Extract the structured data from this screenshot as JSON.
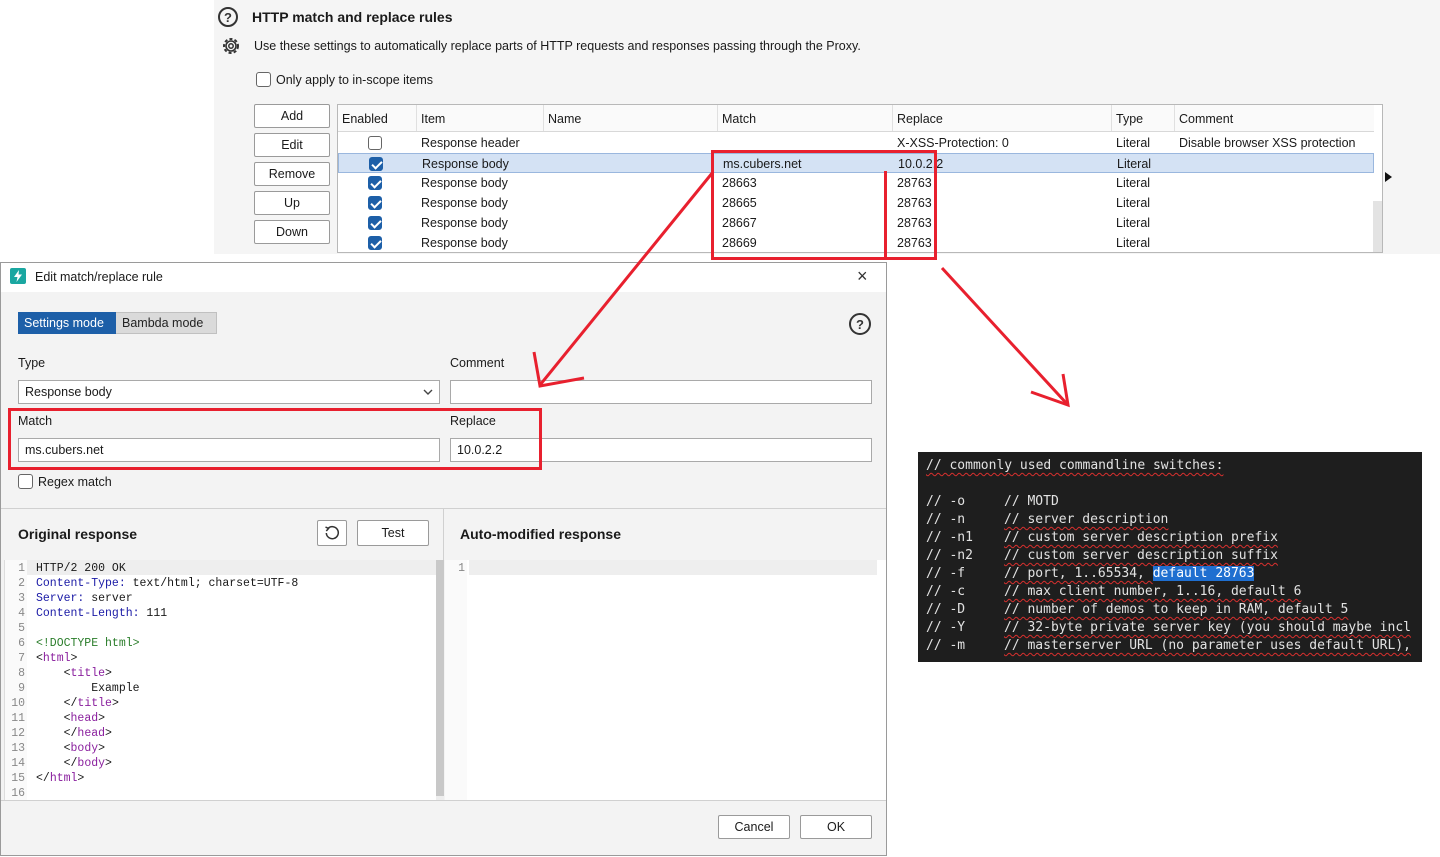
{
  "settings": {
    "section_title": "HTTP match and replace rules",
    "description": "Use these settings to automatically replace parts of HTTP requests and responses passing through the Proxy.",
    "in_scope_label": "Only apply to in-scope items",
    "in_scope_checked": false,
    "buttons": {
      "add": "Add",
      "edit": "Edit",
      "remove": "Remove",
      "up": "Up",
      "down": "Down"
    }
  },
  "rules_table": {
    "columns": [
      "Enabled",
      "Item",
      "Name",
      "Match",
      "Replace",
      "Type",
      "Comment"
    ],
    "rows": [
      {
        "enabled": false,
        "item": "Response header",
        "name": "",
        "match": "",
        "replace": "X-XSS-Protection: 0",
        "type": "Literal",
        "comment": "Disable browser XSS protection",
        "selected": false
      },
      {
        "enabled": true,
        "item": "Response body",
        "name": "",
        "match": "ms.cubers.net",
        "replace": "10.0.2.2",
        "type": "Literal",
        "comment": "",
        "selected": true
      },
      {
        "enabled": true,
        "item": "Response body",
        "name": "",
        "match": "28663",
        "replace": "28763",
        "type": "Literal",
        "comment": "",
        "selected": false
      },
      {
        "enabled": true,
        "item": "Response body",
        "name": "",
        "match": "28665",
        "replace": "28763",
        "type": "Literal",
        "comment": "",
        "selected": false
      },
      {
        "enabled": true,
        "item": "Response body",
        "name": "",
        "match": "28667",
        "replace": "28763",
        "type": "Literal",
        "comment": "",
        "selected": false
      },
      {
        "enabled": true,
        "item": "Response body",
        "name": "",
        "match": "28669",
        "replace": "28763",
        "type": "Literal",
        "comment": "",
        "selected": false
      }
    ]
  },
  "dialog": {
    "title": "Edit match/replace rule",
    "close": "×",
    "modes": {
      "settings": "Settings mode",
      "bambda": "Bambda mode",
      "active": "settings"
    },
    "help": "?",
    "type_label": "Type",
    "type_value": "Response body",
    "comment_label": "Comment",
    "comment_value": "",
    "match_label": "Match",
    "match_value": "ms.cubers.net",
    "replace_label": "Replace",
    "replace_value": "10.0.2.2",
    "regex_label": "Regex match",
    "regex_checked": false,
    "original_title": "Original response",
    "test_button": "Test",
    "modified_title": "Auto-modified response",
    "modified_line_number": "1",
    "cancel": "Cancel",
    "ok": "OK",
    "original_lines": [
      "HTTP/2 200 OK",
      "Content-Type: text/html; charset=UTF-8",
      "Server: server",
      "Content-Length: 111",
      "",
      "<!DOCTYPE html>",
      "<html>",
      "    <title>",
      "        Example",
      "    </title>",
      "    <head>",
      "    </head>",
      "    <body>",
      "    </body>",
      "</html>",
      ""
    ]
  },
  "code_snippet": {
    "header": "// commonly used commandline switches:",
    "switches": [
      {
        "flag": "// -o",
        "desc": "// MOTD"
      },
      {
        "flag": "// -n",
        "desc": "// server description"
      },
      {
        "flag": "// -n1",
        "desc": "// custom server description prefix"
      },
      {
        "flag": "// -n2",
        "desc": "// custom server description suffix"
      },
      {
        "flag": "// -f",
        "desc": "// port, 1..65534, ",
        "highlight": "default 28763"
      },
      {
        "flag": "// -c",
        "desc": "// max client number, 1..16, default 6"
      },
      {
        "flag": "// -D",
        "desc": "// number of demos to keep in RAM, default 5"
      },
      {
        "flag": "// -Y",
        "desc": "// 32-byte private server key (you should maybe incl"
      },
      {
        "flag": "// -m",
        "desc": "// masterserver URL (no parameter uses default URL),"
      }
    ]
  },
  "colors": {
    "accent": "#1d5fa8",
    "annotation": "#e8202e",
    "code_bg": "#1e1e1e"
  }
}
